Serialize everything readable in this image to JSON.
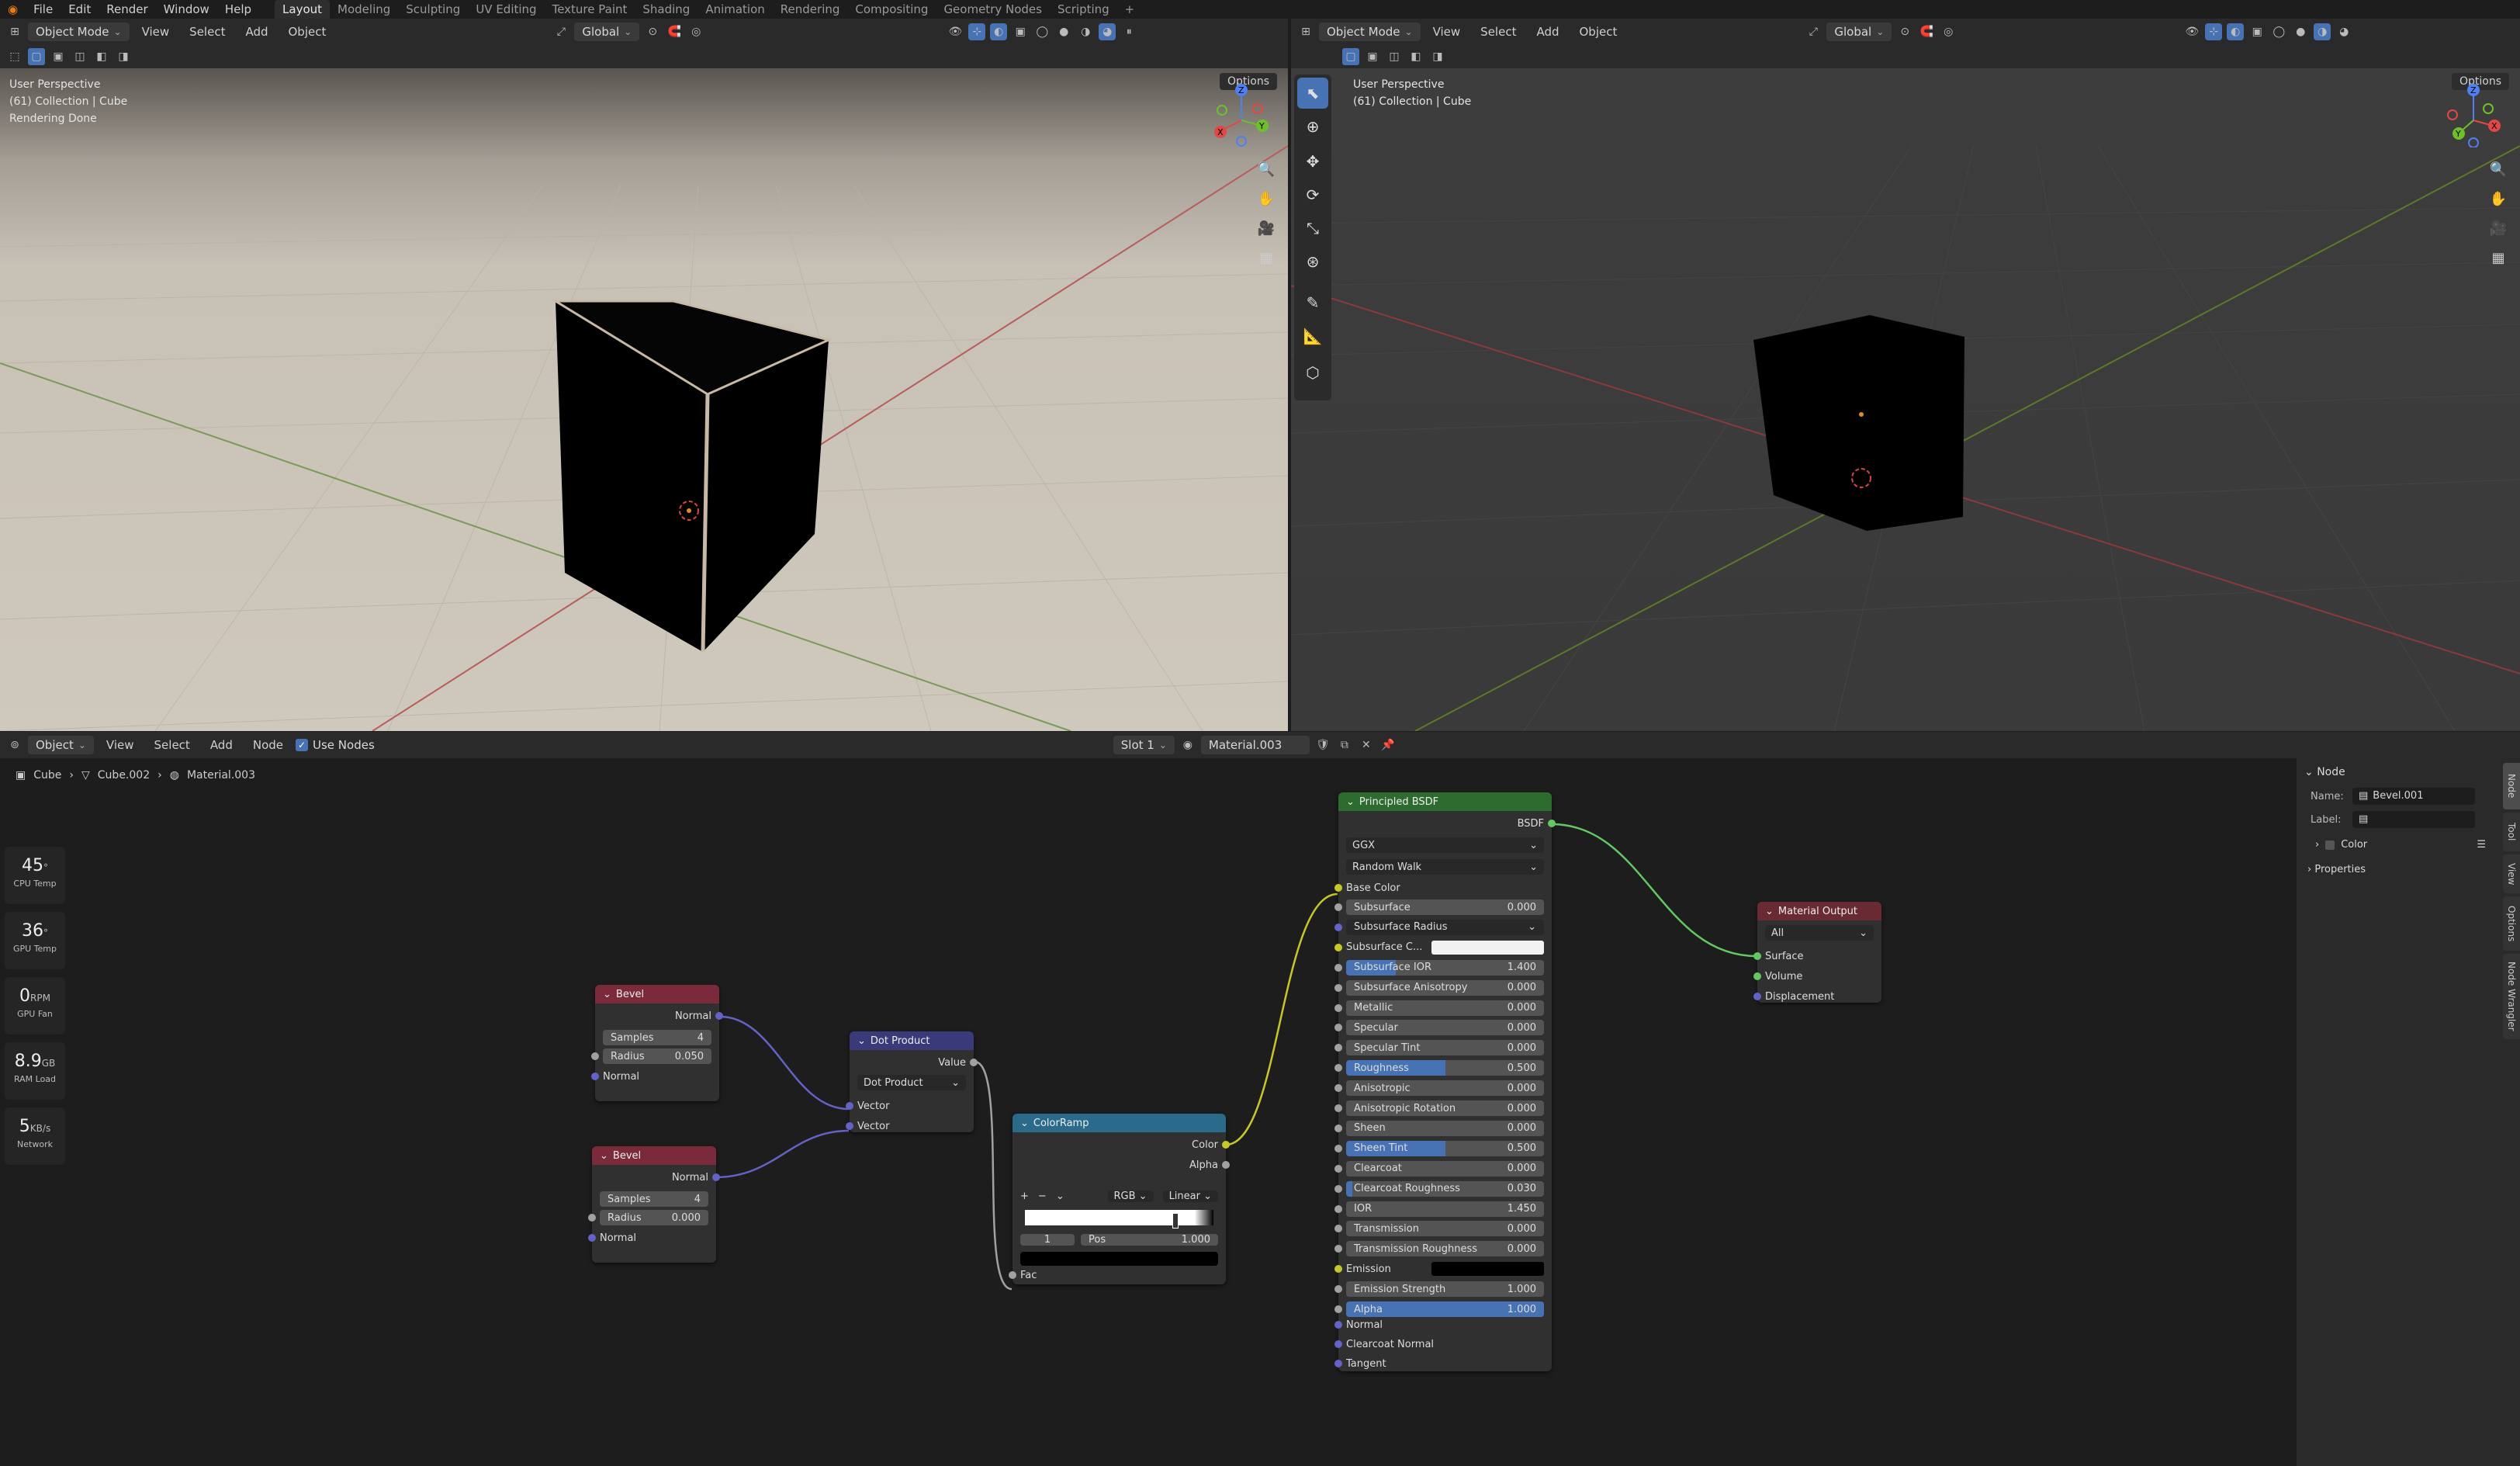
{
  "topbar": {
    "menus": [
      "File",
      "Edit",
      "Render",
      "Window",
      "Help"
    ],
    "workspaces": [
      "Layout",
      "Modeling",
      "Sculpting",
      "UV Editing",
      "Texture Paint",
      "Shading",
      "Animation",
      "Rendering",
      "Compositing",
      "Geometry Nodes",
      "Scripting"
    ],
    "active_workspace": "Layout",
    "add_tab": "+"
  },
  "viewport_left": {
    "mode": "Object Mode",
    "menus": [
      "View",
      "Select",
      "Add",
      "Object"
    ],
    "orientation": "Global",
    "options": "Options",
    "overlay": [
      "User Perspective",
      "(61) Collection | Cube",
      "Rendering Done"
    ],
    "axes": {
      "z": "Z",
      "y": "Y",
      "x": "X"
    }
  },
  "viewport_right": {
    "mode": "Object Mode",
    "menus": [
      "View",
      "Select",
      "Add",
      "Object"
    ],
    "orientation": "Global",
    "options": "Options",
    "overlay": [
      "User Perspective",
      "(61) Collection | Cube"
    ],
    "axes": {
      "z": "Z",
      "y": "Y",
      "x": "X"
    }
  },
  "node_editor": {
    "object_type": "Object",
    "menus": [
      "View",
      "Select",
      "Add",
      "Node"
    ],
    "use_nodes_label": "Use Nodes",
    "use_nodes": true,
    "slot": "Slot 1",
    "material": "Material.003",
    "breadcrumb": [
      "Cube",
      "Cube.002",
      "Material.003"
    ]
  },
  "stats": [
    {
      "value": "45",
      "unit": "°",
      "label": "CPU Temp"
    },
    {
      "value": "36",
      "unit": "°",
      "label": "GPU Temp"
    },
    {
      "value": "0",
      "unit": "RPM",
      "label": "GPU Fan"
    },
    {
      "value": "8.9",
      "unit": "GB",
      "label": "RAM Load"
    },
    {
      "value": "5",
      "unit": "KB/s",
      "label": "Network"
    }
  ],
  "nodes": {
    "bevel1": {
      "title": "Bevel",
      "out": "Normal",
      "samples_label": "Samples",
      "samples": "4",
      "radius_label": "Radius",
      "radius": "0.050",
      "in": "Normal"
    },
    "bevel2": {
      "title": "Bevel",
      "out": "Normal",
      "samples_label": "Samples",
      "samples": "4",
      "radius_label": "Radius",
      "radius": "0.000",
      "in": "Normal"
    },
    "dot": {
      "title": "Dot Product",
      "out": "Value",
      "op": "Dot Product",
      "in1": "Vector",
      "in2": "Vector"
    },
    "ramp": {
      "title": "ColorRamp",
      "out1": "Color",
      "out2": "Alpha",
      "mode": "RGB",
      "interp": "Linear",
      "index": "1",
      "pos_label": "Pos",
      "pos": "1.000",
      "in": "Fac",
      "add": "+",
      "remove": "−"
    },
    "bsdf": {
      "title": "Principled BSDF",
      "out": "BSDF",
      "dist": "GGX",
      "sss": "Random Walk",
      "base_color": "Base Color",
      "fields": [
        {
          "label": "Subsurface",
          "value": "0.000",
          "fill": 0
        },
        {
          "label": "Subsurface Radius",
          "value": "",
          "fill": 0,
          "dropdown": true
        },
        {
          "label": "Subsurface C...",
          "value": "",
          "fill": 0,
          "color": true
        },
        {
          "label": "Subsurface IOR",
          "value": "1.400",
          "fill": 0.25
        },
        {
          "label": "Subsurface Anisotropy",
          "value": "0.000",
          "fill": 0
        },
        {
          "label": "Metallic",
          "value": "0.000",
          "fill": 0
        },
        {
          "label": "Specular",
          "value": "0.000",
          "fill": 0
        },
        {
          "label": "Specular Tint",
          "value": "0.000",
          "fill": 0
        },
        {
          "label": "Roughness",
          "value": "0.500",
          "fill": 0.5
        },
        {
          "label": "Anisotropic",
          "value": "0.000",
          "fill": 0
        },
        {
          "label": "Anisotropic Rotation",
          "value": "0.000",
          "fill": 0
        },
        {
          "label": "Sheen",
          "value": "0.000",
          "fill": 0
        },
        {
          "label": "Sheen Tint",
          "value": "0.500",
          "fill": 0.5
        },
        {
          "label": "Clearcoat",
          "value": "0.000",
          "fill": 0
        },
        {
          "label": "Clearcoat Roughness",
          "value": "0.030",
          "fill": 0.03
        },
        {
          "label": "IOR",
          "value": "1.450",
          "fill": 0
        },
        {
          "label": "Transmission",
          "value": "0.000",
          "fill": 0
        },
        {
          "label": "Transmission Roughness",
          "value": "0.000",
          "fill": 0
        },
        {
          "label": "Emission",
          "value": "",
          "fill": 0,
          "color_black": true
        },
        {
          "label": "Emission Strength",
          "value": "1.000",
          "fill": 0
        },
        {
          "label": "Alpha",
          "value": "1.000",
          "fill": 1
        }
      ],
      "inputs_tail": [
        "Normal",
        "Clearcoat Normal",
        "Tangent"
      ]
    },
    "output": {
      "title": "Material Output",
      "target": "All",
      "in1": "Surface",
      "in2": "Volume",
      "in3": "Displacement"
    }
  },
  "npanel": {
    "section": "Node",
    "name_label": "Name:",
    "name": "Bevel.001",
    "label_label": "Label:",
    "label": "",
    "color": "Color",
    "properties": "Properties",
    "tabs": [
      "Node",
      "Tool",
      "View",
      "Options",
      "Node Wrangler"
    ]
  },
  "colors": {
    "bevel_header": "#7a2a3a",
    "dot_header": "#3a3a7a",
    "ramp_header": "#2a6a8a",
    "bsdf_header": "#2e6b2e",
    "output_header": "#6a2a33",
    "socket_vector": "#6363c7",
    "socket_float": "#a1a1a1",
    "socket_color": "#c7c729",
    "socket_shader": "#63c763",
    "accent": "#4772b3"
  }
}
